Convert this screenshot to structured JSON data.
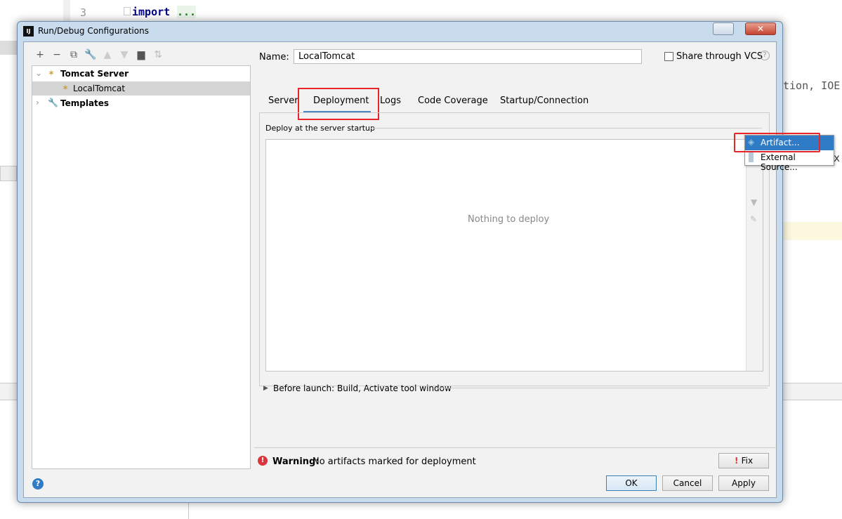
{
  "editor": {
    "line_number": "3",
    "code_import": "import",
    "code_ellipsis": "...",
    "code_fragment1": "tion, IOE",
    "code_fragment2": "x"
  },
  "dialog": {
    "title": "Run/Debug Configurations"
  },
  "toolbar": {
    "icons": [
      "plus-icon",
      "minus-icon",
      "copy-icon",
      "wrench-icon",
      "arrow-up-icon",
      "arrow-down-icon",
      "folder-add-icon",
      "sort-icon"
    ]
  },
  "tree": {
    "items": [
      {
        "label": "Tomcat Server",
        "expanded": true
      },
      {
        "label": "LocalTomcat",
        "selected": true
      },
      {
        "label": "Templates",
        "expanded": false
      }
    ]
  },
  "name_label": "Name:",
  "name_value": "LocalTomcat",
  "share_label": "Share through VCS",
  "share_checked": false,
  "tabs": [
    {
      "label": "Server"
    },
    {
      "label": "Deployment",
      "active": true
    },
    {
      "label": "Logs"
    },
    {
      "label": "Code Coverage"
    },
    {
      "label": "Startup/Connection"
    }
  ],
  "deploy": {
    "section_label": "Deploy at the server startup",
    "empty_text": "Nothing to deploy"
  },
  "popup": {
    "items": [
      {
        "label": "Artifact...",
        "selected": true
      },
      {
        "label": "External Source..."
      }
    ]
  },
  "before_launch": "Before launch: Build, Activate tool window",
  "warning": {
    "bold": "Warning:",
    "text": "No artifacts marked for deployment",
    "fix_label": "Fix"
  },
  "buttons": {
    "ok": "OK",
    "cancel": "Cancel",
    "apply": "Apply"
  },
  "colors": {
    "accent": "#2f7bc5",
    "highlight_red": "#e8262a",
    "selection": "#d5d5d5"
  }
}
